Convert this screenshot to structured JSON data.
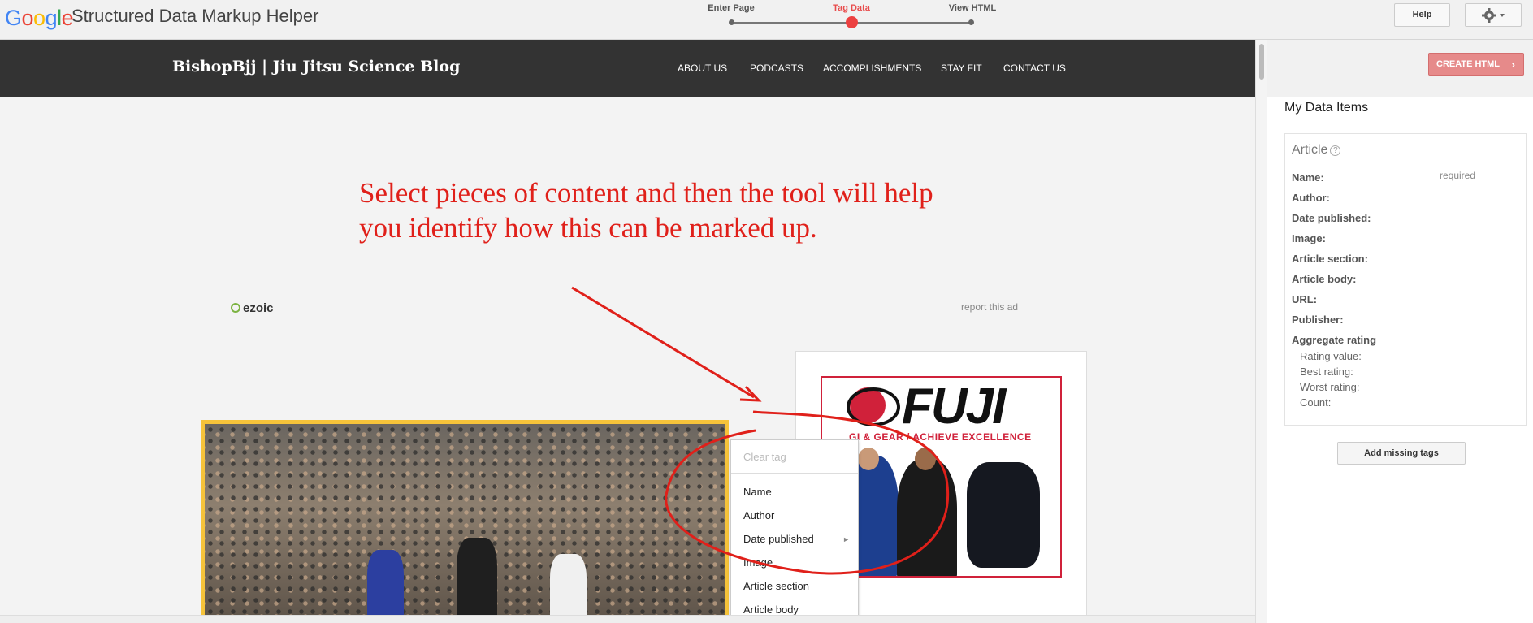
{
  "app": {
    "logo_letters": [
      "G",
      "o",
      "o",
      "g",
      "l",
      "e"
    ],
    "title": "Structured Data Markup Helper",
    "steps": [
      "Enter Page",
      "Tag Data",
      "View HTML"
    ],
    "active_step": "Tag Data",
    "help_label": "Help"
  },
  "site": {
    "title": "BishopBjj | Jiu Jitsu Science Blog",
    "nav": [
      "ABOUT US",
      "PODCASTS",
      "ACCOMPLISHMENTS",
      "STAY FIT",
      "CONTACT US"
    ]
  },
  "annotation": {
    "line1": "Select pieces of content and then the tool will help",
    "line2": "you identify how this can be marked up."
  },
  "ad": {
    "ezoic_label": "ezoic",
    "report_label": "report this ad",
    "fuji_brand": "FUJI",
    "fuji_tagline": "GI & GEAR / ACHIEVE EXCELLENCE"
  },
  "context_menu": {
    "clear_label": "Clear tag",
    "items": [
      "Name",
      "Author",
      "Date published",
      "Image",
      "Article section",
      "Article body"
    ]
  },
  "panel": {
    "create_label": "CREATE HTML",
    "heading": "My Data Items",
    "card_title": "Article",
    "required_label": "required",
    "fields": [
      "Name:",
      "Author:",
      "Date published:",
      "Image:",
      "Article section:",
      "Article body:",
      "URL:",
      "Publisher:",
      "Aggregate rating"
    ],
    "rating_fields": [
      "Rating value:",
      "Best rating:",
      "Worst rating:",
      "Count:"
    ],
    "add_missing_label": "Add missing tags"
  },
  "colors": {
    "accent_red": "#e0201a",
    "active_step": "#ec4040",
    "site_bar": "#333333",
    "photo_border": "#f6c33a"
  }
}
